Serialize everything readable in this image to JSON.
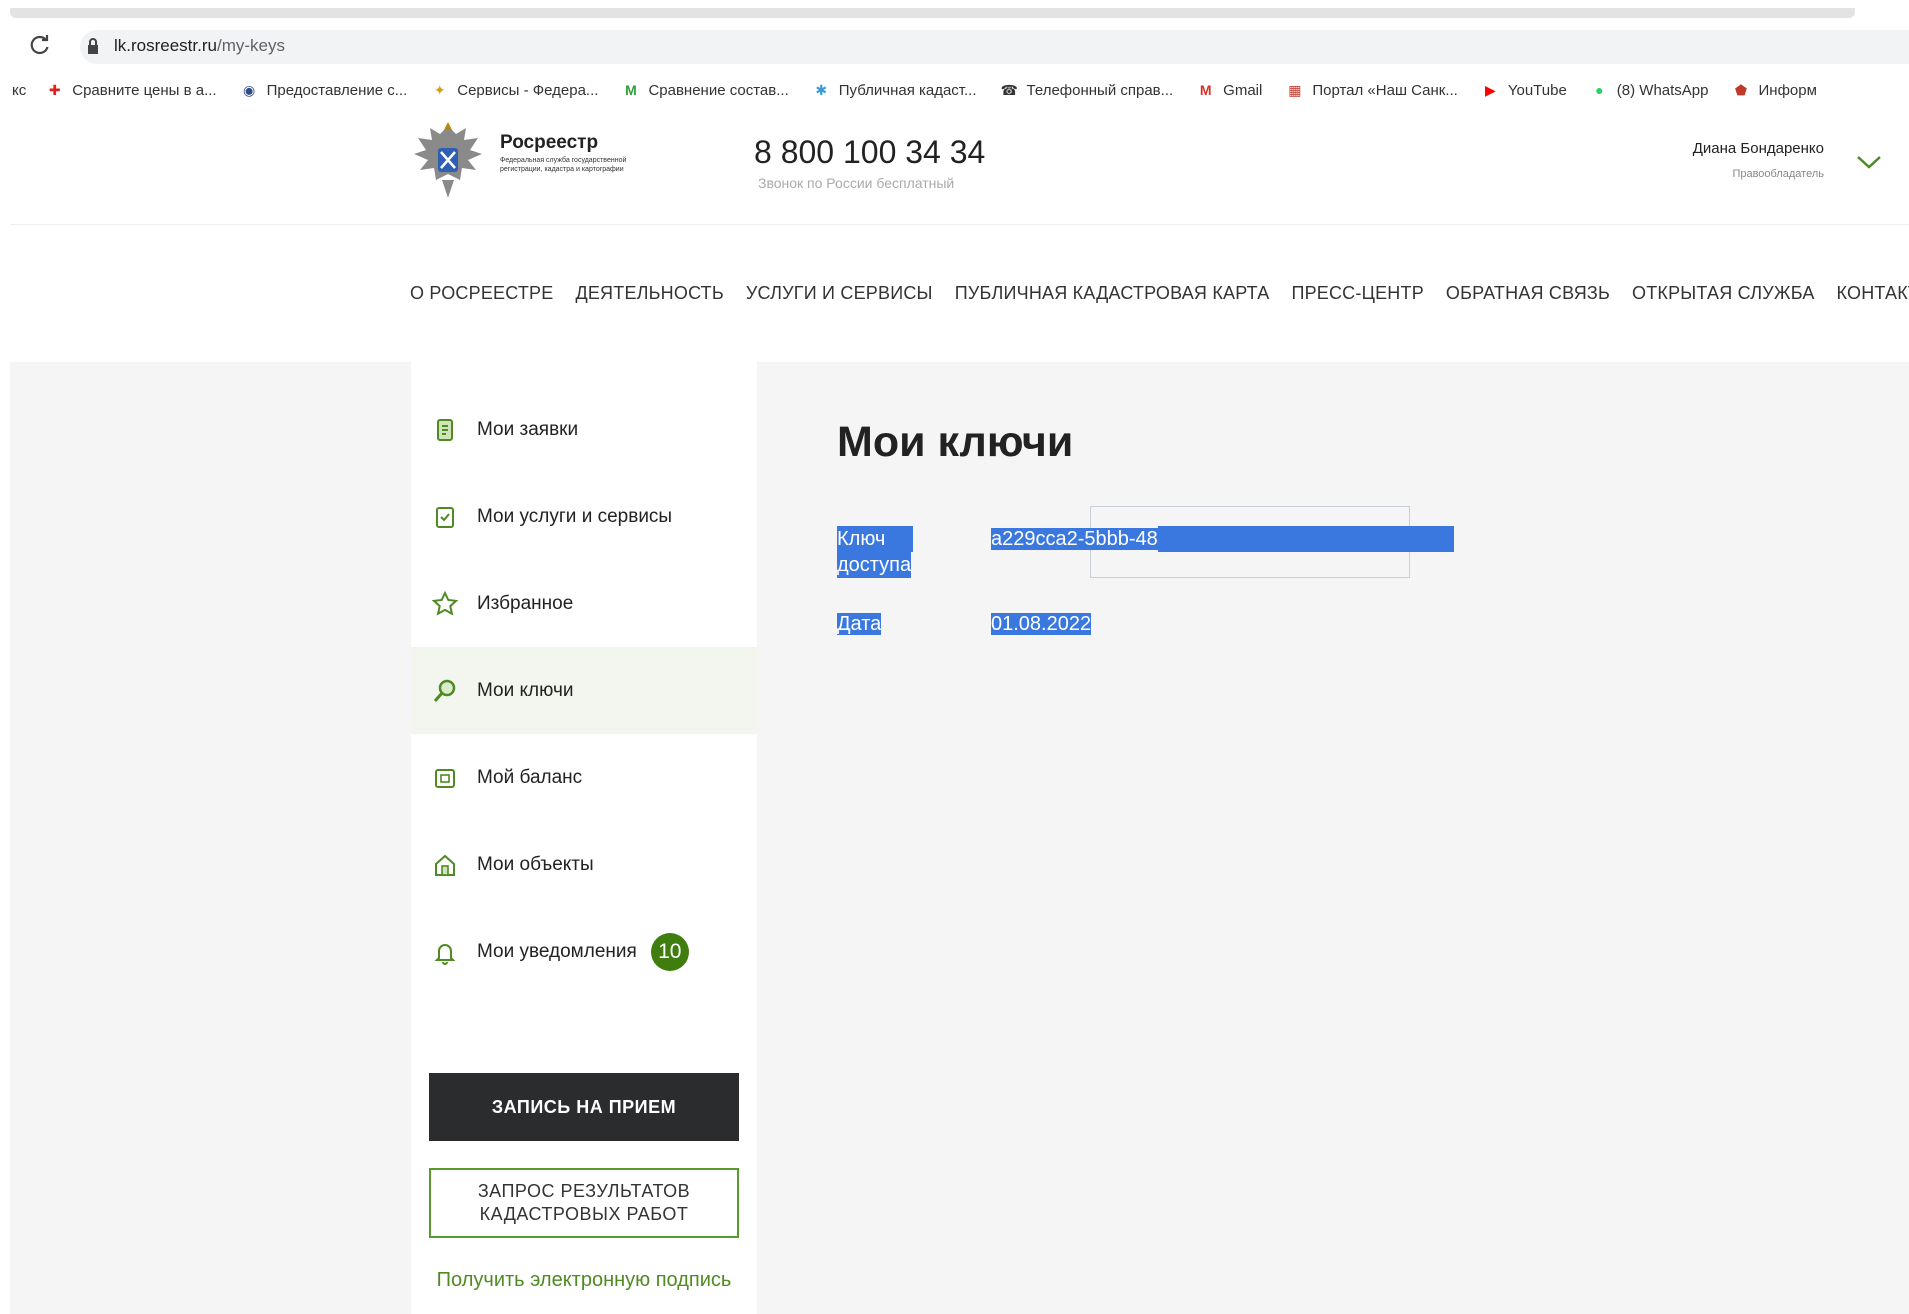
{
  "browser": {
    "url_host": "lk.rosreestr.ru",
    "url_path": "/my-keys",
    "bookmarks": [
      {
        "label": "кс",
        "icon": ""
      },
      {
        "label": "Сравните цены в а...",
        "icon": "red-cross-icon",
        "color": "#e02020"
      },
      {
        "label": "Предоставление с...",
        "icon": "gov-emblem-icon",
        "color": "#2f4c8a"
      },
      {
        "label": "Сервисы - Федера...",
        "icon": "eagle-icon",
        "color": "#d4a017"
      },
      {
        "label": "Сравнение состав...",
        "icon": "m-letter-icon",
        "color": "#2e9e3e"
      },
      {
        "label": "Публичная кадаст...",
        "icon": "map-pin-icon",
        "color": "#3a9ad9"
      },
      {
        "label": "Телефонный справ...",
        "icon": "phone-icon",
        "color": "#333333"
      },
      {
        "label": "Gmail",
        "icon": "gmail-icon",
        "color": "#d93025"
      },
      {
        "label": "Портал «Наш Санк...",
        "icon": "portal-icon",
        "color": "#c0392b"
      },
      {
        "label": "YouTube",
        "icon": "youtube-icon",
        "color": "#ff0000"
      },
      {
        "label": "(8) WhatsApp",
        "icon": "whatsapp-icon",
        "color": "#25d366"
      },
      {
        "label": "Информ",
        "icon": "shield-icon",
        "color": "#c0392b"
      }
    ]
  },
  "header": {
    "logo_name": "Росреестр",
    "logo_sub": "Федеральная служба государственной регистрации, кадастра и картографии",
    "phone": "8 800 100 34 34",
    "phone_note": "Звонок по России бесплатный",
    "user_name": "Диана Бондаренко",
    "user_role": "Правообладатель"
  },
  "nav": [
    "О РОСРЕЕСТРЕ",
    "ДЕЯТЕЛЬНОСТЬ",
    "УСЛУГИ И СЕРВИСЫ",
    "ПУБЛИЧНАЯ КАДАСТРОВАЯ КАРТА",
    "ПРЕСС-ЦЕНТР",
    "ОБРАТНАЯ СВЯЗЬ",
    "ОТКРЫТАЯ СЛУЖБА",
    "КОНТАКТЫ"
  ],
  "sidebar": {
    "items": [
      {
        "label": "Мои заявки",
        "icon": "document-icon"
      },
      {
        "label": "Мои услуги и сервисы",
        "icon": "checklist-icon"
      },
      {
        "label": "Избранное",
        "icon": "star-icon"
      },
      {
        "label": "Мои ключи",
        "icon": "key-icon",
        "active": true
      },
      {
        "label": "Мой баланс",
        "icon": "wallet-icon"
      },
      {
        "label": "Мои объекты",
        "icon": "house-icon"
      },
      {
        "label": "Мои уведомления",
        "icon": "bell-icon",
        "badge": "10"
      }
    ],
    "btn_appointment": "ЗАПИСЬ НА ПРИЕМ",
    "btn_cadastral": "ЗАПРОС РЕЗУЛЬТАТОВ КАДАСТРОВЫХ РАБОТ",
    "link_signature": "Получить электронную подпись"
  },
  "content": {
    "title": "Мои ключи",
    "key_label_1": "Ключ",
    "key_label_2": "доступа",
    "key_value": "a229cca2-5bbb-48",
    "date_label": "Дата",
    "date_value": "01.08.2022"
  },
  "colors": {
    "accent_green": "#3f7d0f",
    "selection_blue": "#3a78e0",
    "dark_button": "#2a2c2e"
  }
}
